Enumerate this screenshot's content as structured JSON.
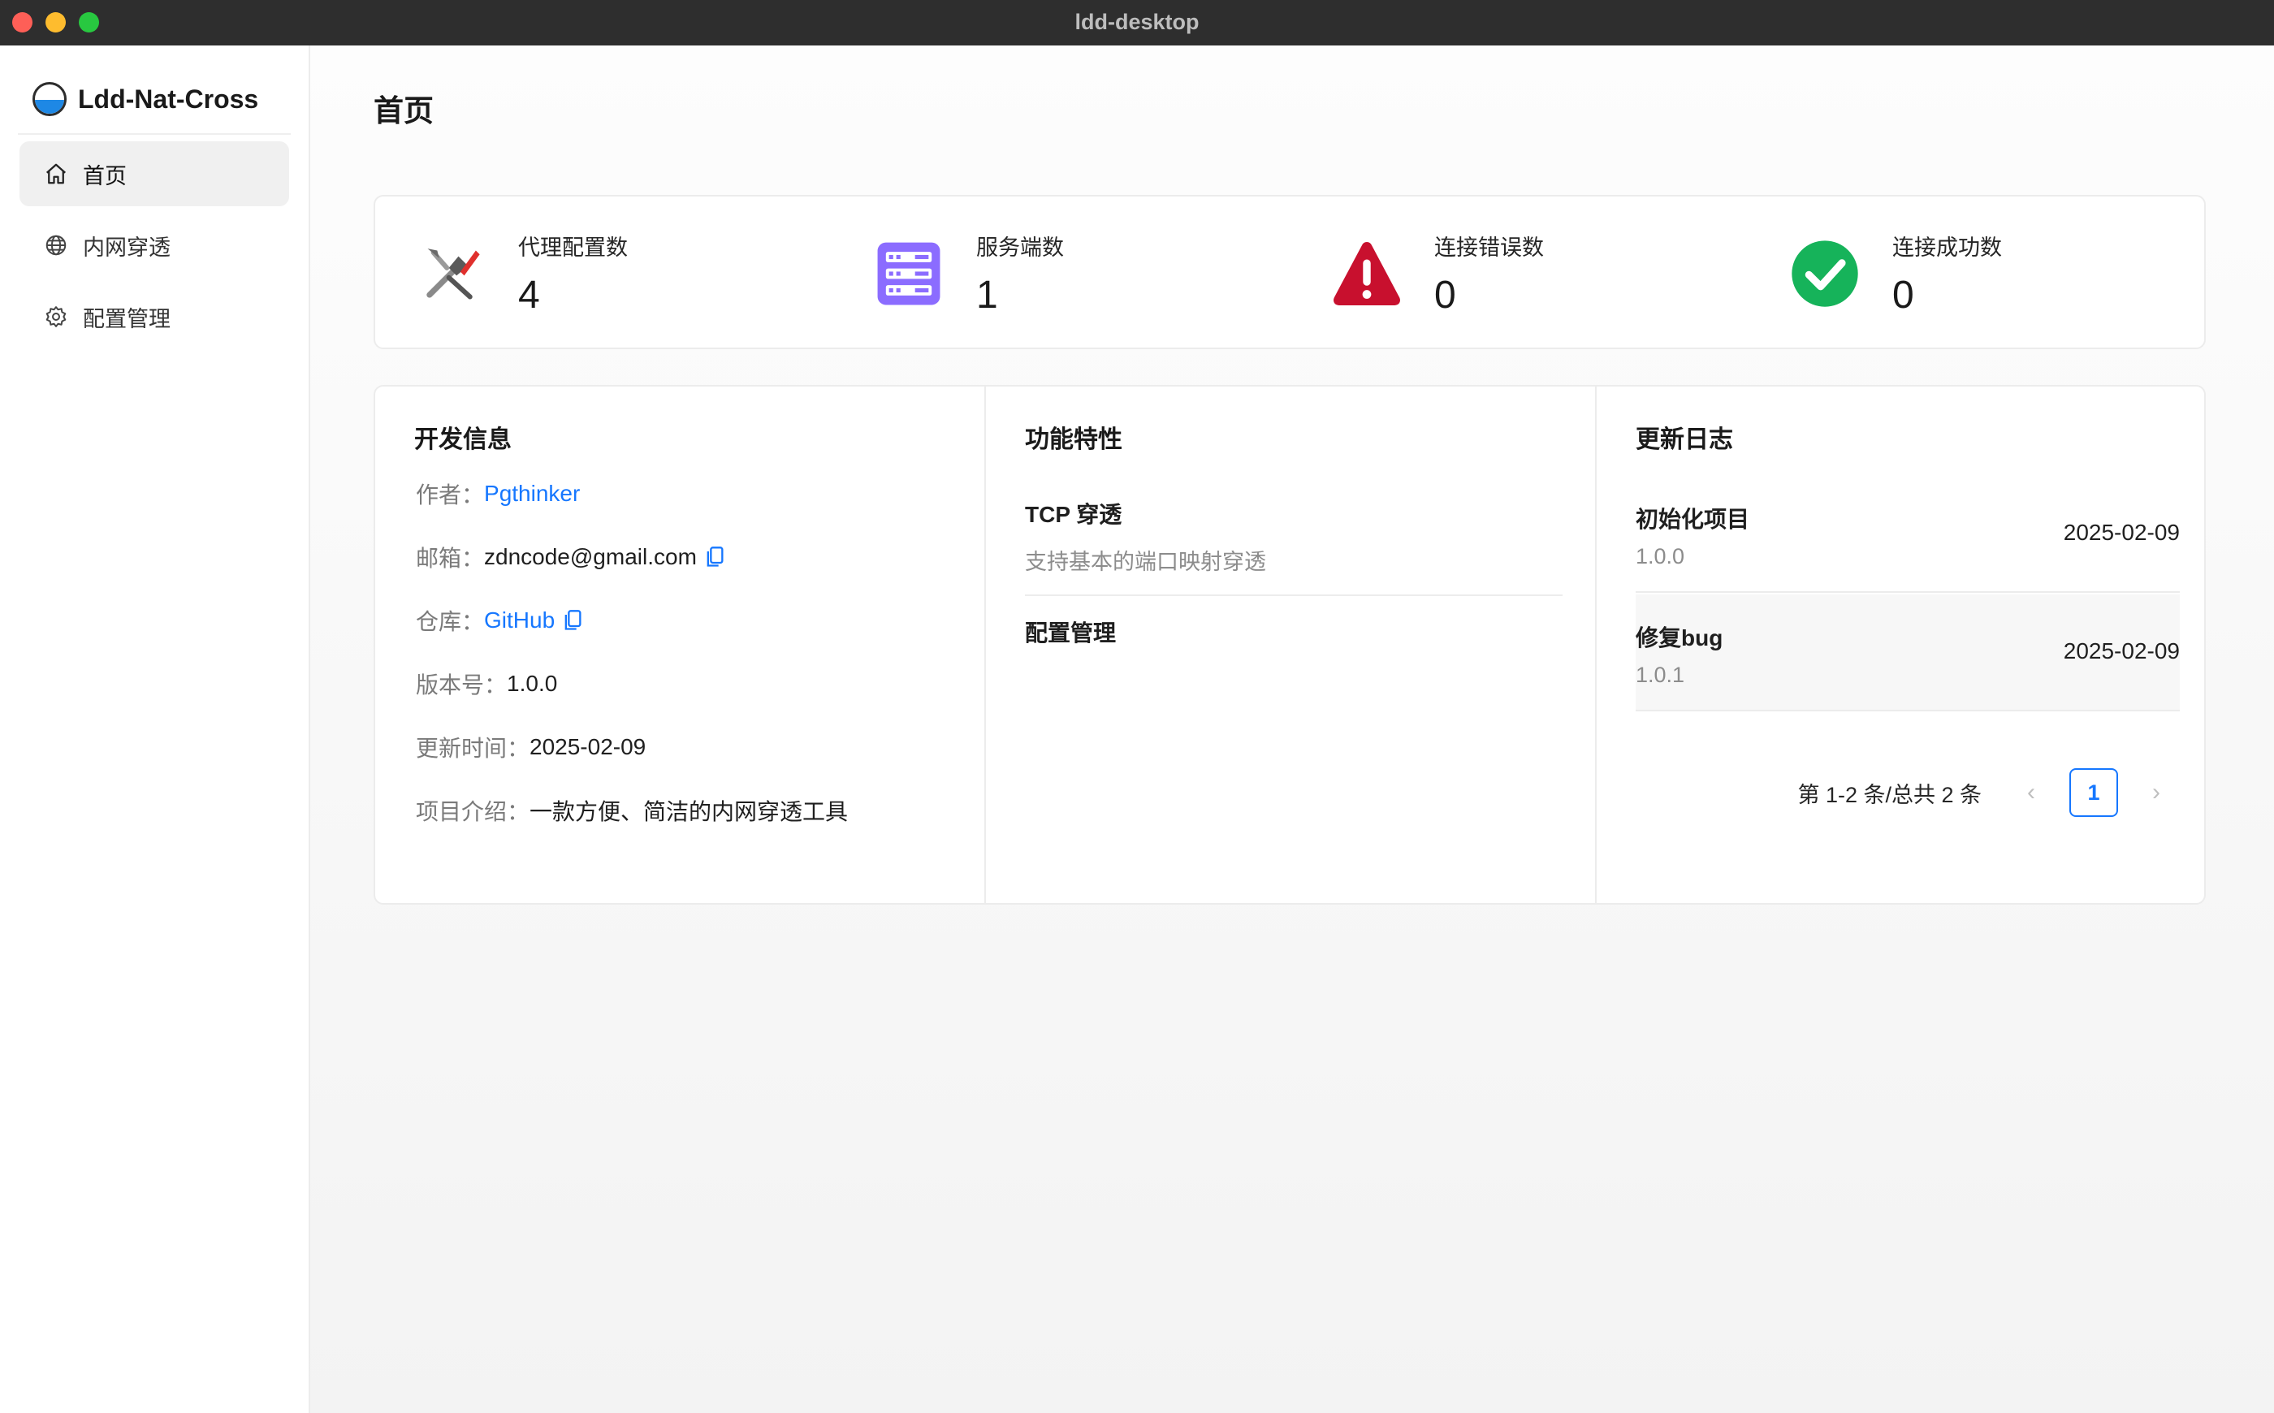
{
  "window": {
    "title": "ldd-desktop"
  },
  "sidebar": {
    "app_name": "Ldd-Nat-Cross",
    "items": [
      {
        "label": "首页",
        "icon": "home-icon",
        "active": true
      },
      {
        "label": "内网穿透",
        "icon": "globe-icon",
        "active": false
      },
      {
        "label": "配置管理",
        "icon": "gear-icon",
        "active": false
      }
    ]
  },
  "main": {
    "title": "首页",
    "stats": [
      {
        "label": "代理配置数",
        "value": "4",
        "icon": "tools-icon"
      },
      {
        "label": "服务端数",
        "value": "1",
        "icon": "server-icon"
      },
      {
        "label": "连接错误数",
        "value": "0",
        "icon": "warning-icon"
      },
      {
        "label": "连接成功数",
        "value": "0",
        "icon": "check-icon"
      }
    ],
    "dev_info": {
      "title": "开发信息",
      "author_label": "作者：",
      "author": "Pgthinker",
      "email_label": "邮箱：",
      "email": "zdncode@gmail.com",
      "repo_label": "仓库：",
      "repo": "GitHub",
      "version_label": "版本号：",
      "version": "1.0.0",
      "updated_label": "更新时间：",
      "updated": "2025-02-09",
      "intro_label": "项目介绍：",
      "intro": "一款方便、简洁的内网穿透工具"
    },
    "features": {
      "title": "功能特性",
      "items": [
        {
          "title": "TCP 穿透",
          "desc": "支持基本的端口映射穿透"
        },
        {
          "title": "配置管理",
          "desc": ""
        }
      ]
    },
    "changelog": {
      "title": "更新日志",
      "items": [
        {
          "title": "初始化项目",
          "version": "1.0.0",
          "date": "2025-02-09"
        },
        {
          "title": "修复bug",
          "version": "1.0.1",
          "date": "2025-02-09"
        }
      ],
      "pagination": {
        "total_text": "第 1-2 条/总共 2 条",
        "prev": "‹",
        "current": "1",
        "next": "›"
      }
    }
  },
  "colors": {
    "accent": "#1677ff",
    "server": "#7b61ff",
    "warning": "#c8102e",
    "success": "#16b35a"
  }
}
